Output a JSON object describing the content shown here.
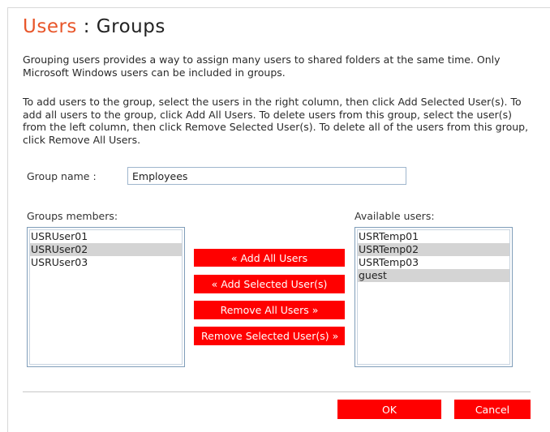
{
  "title": {
    "part1": "Users",
    "separator": " : ",
    "part2": "Groups"
  },
  "description": [
    "Grouping users provides a way to assign many users to shared folders at the same time. Only Microsoft Windows users can be included in groups.",
    "To add users to the group, select the users in the right column, then click Add Selected User(s). To add all users to the group, click Add All Users. To delete users from this group, select the user(s) from the left column, then click Remove Selected User(s). To delete all of the users from this group, click Remove All Users."
  ],
  "group_name": {
    "label": "Group name   :",
    "value": "Employees"
  },
  "members": {
    "label": "Groups members:",
    "items": [
      {
        "name": "USRUser01",
        "selected": false
      },
      {
        "name": "USRUser02",
        "selected": true
      },
      {
        "name": "USRUser03",
        "selected": false
      }
    ]
  },
  "available": {
    "label": "Available users:",
    "items": [
      {
        "name": "USRTemp01",
        "selected": false
      },
      {
        "name": "USRTemp02",
        "selected": true
      },
      {
        "name": "USRTemp03",
        "selected": false
      },
      {
        "name": "guest",
        "selected": true
      }
    ]
  },
  "buttons": {
    "add_all": "« Add All Users",
    "add_selected": "« Add Selected User(s)",
    "remove_all": "Remove All Users »",
    "remove_selected": "Remove Selected User(s) »",
    "ok": "OK",
    "cancel": "Cancel"
  },
  "colors": {
    "accent": "#e8562a",
    "button_bg": "#ff0000",
    "button_text": "#ffffff",
    "selection": "#d4d4d4"
  }
}
